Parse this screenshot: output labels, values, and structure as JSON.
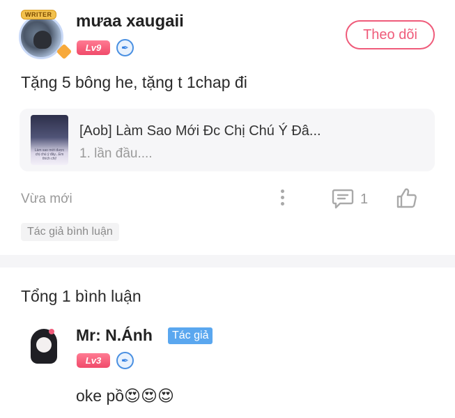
{
  "post": {
    "avatar_badge": "WRITER",
    "username": "mưaa xaugaii",
    "level": "Lv9",
    "verify_icon": "quill-badge-icon",
    "follow_label": "Theo dõi",
    "content": "Tặng 5 bông he, tặng t 1chap đi",
    "linked_story": {
      "title": "[Aob] Làm Sao Mới Đc Chị Chú Ý Đâ...",
      "subtitle": "1. lần đầu....",
      "thumb_text": "Làm sao mới được chị chú ý đây...Em thích chị!"
    },
    "time": "Vừa mới",
    "comment_count": "1",
    "author_comment_tag": "Tác giả bình luận"
  },
  "comments": {
    "total": "Tổng 1 bình luận",
    "items": [
      {
        "name": "Mr: N.Ánh",
        "badge": "Tác giả",
        "level": "Lv3",
        "text": "oke pồ😍😍😍"
      }
    ]
  },
  "colors": {
    "accent_pink": "#ef5b7a",
    "author_blue": "#5aa7ef"
  }
}
